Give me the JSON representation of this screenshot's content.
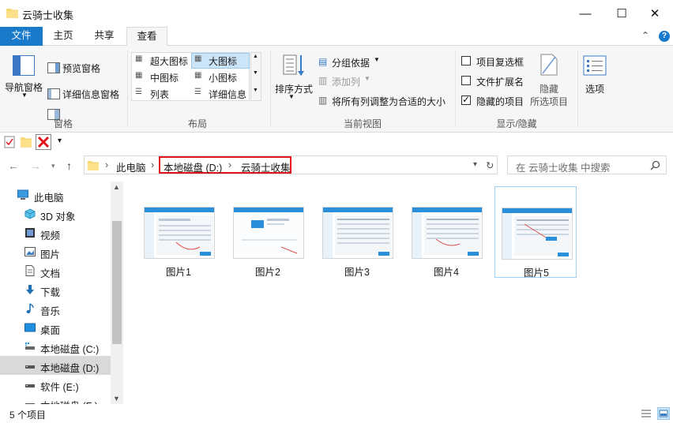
{
  "window": {
    "title": "云骑士收集",
    "min_glyph": "—",
    "max_glyph": "☐",
    "close_glyph": "✕"
  },
  "tabs": [
    {
      "label": "文件"
    },
    {
      "label": "主页"
    },
    {
      "label": "共享"
    },
    {
      "label": "查看"
    }
  ],
  "ribbon": {
    "panes": {
      "nav_pane": "导航窗格",
      "preview_pane": "预览窗格",
      "details_pane": "详细信息窗格",
      "group": "窗格"
    },
    "layout": {
      "xl_icons": "超大图标",
      "l_icons": "大图标",
      "m_icons": "中图标",
      "s_icons": "小图标",
      "list": "列表",
      "details": "详细信息",
      "group": "布局"
    },
    "current_view": {
      "sort": "排序方式",
      "group_by": "分组依据",
      "add_col": "添加列",
      "fit_cols": "将所有列调整为合适的大小",
      "group": "当前视图"
    },
    "show_hide": {
      "item_checkbox": "项目复选框",
      "file_ext": "文件扩展名",
      "hidden_items": "隐藏的项目",
      "hide": "隐藏",
      "selected_items": "所选项目",
      "options": "选项",
      "group": "显示/隐藏"
    }
  },
  "address": {
    "segments": [
      "此电脑",
      "本地磁盘 (D:)",
      "云骑士收集"
    ],
    "sep": "›"
  },
  "search": {
    "placeholder": "在 云骑士收集 中搜索"
  },
  "sidebar": {
    "items": [
      {
        "label": "此电脑",
        "icon": "pc-icon"
      },
      {
        "label": "3D 对象",
        "icon": "cube-icon"
      },
      {
        "label": "视频",
        "icon": "video-icon"
      },
      {
        "label": "图片",
        "icon": "image-icon"
      },
      {
        "label": "文档",
        "icon": "document-icon"
      },
      {
        "label": "下载",
        "icon": "download-icon"
      },
      {
        "label": "音乐",
        "icon": "music-icon"
      },
      {
        "label": "桌面",
        "icon": "desktop-icon"
      },
      {
        "label": "本地磁盘 (C:)",
        "icon": "drive-icon"
      },
      {
        "label": "本地磁盘 (D:)",
        "icon": "drive-icon"
      },
      {
        "label": "软件 (E:)",
        "icon": "drive-icon"
      },
      {
        "label": "本地磁盘 (F:)",
        "icon": "drive-icon"
      }
    ]
  },
  "files": [
    {
      "name": "图片1"
    },
    {
      "name": "图片2"
    },
    {
      "name": "图片3"
    },
    {
      "name": "图片4"
    },
    {
      "name": "图片5"
    }
  ],
  "status": {
    "count": "5 个项目"
  },
  "colors": {
    "accent": "#1979ca",
    "selection": "#cce4f7",
    "highlight_border": "#e0141b"
  }
}
